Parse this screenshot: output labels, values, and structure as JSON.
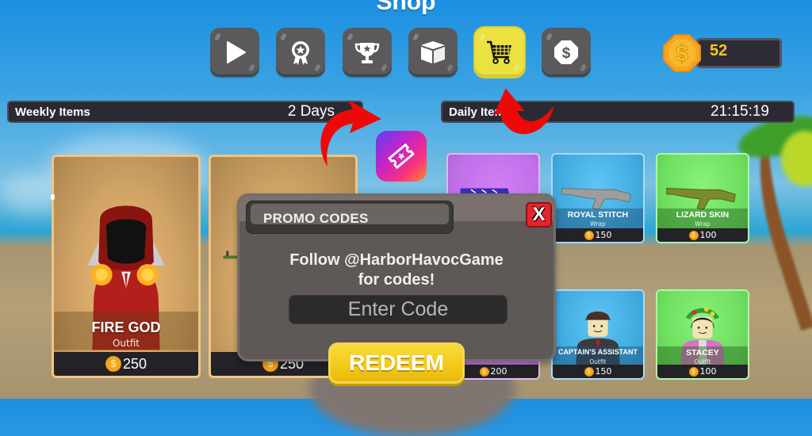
{
  "title": "Shop",
  "nav": [
    {
      "name": "play",
      "icon": "play-icon",
      "active": false
    },
    {
      "name": "rewards",
      "icon": "ribbon-award-icon",
      "active": false
    },
    {
      "name": "trophies",
      "icon": "trophy-icon",
      "active": false
    },
    {
      "name": "crates",
      "icon": "box-icon",
      "active": false
    },
    {
      "name": "shop",
      "icon": "shopping-cart-icon",
      "active": true
    },
    {
      "name": "robux",
      "icon": "dollar-coin-icon",
      "active": false
    }
  ],
  "currency": {
    "icon": "gold-coin-icon",
    "amount": "52"
  },
  "weekly": {
    "label": "Weekly Items",
    "timer": "2 Days"
  },
  "daily": {
    "label": "Daily Items",
    "timer": "21:15:19"
  },
  "weekly_items": [
    {
      "name": "FIRE GOD",
      "type": "Outfit",
      "price": "250"
    },
    {
      "name": "",
      "type": "",
      "price": "250"
    }
  ],
  "daily_items": [
    {
      "name": "",
      "type": "",
      "price": "",
      "rarity": "purple"
    },
    {
      "name": "ROYAL STITCH",
      "type": "Wrap",
      "price": "150",
      "rarity": "blue"
    },
    {
      "name": "LIZARD SKIN",
      "type": "Wrap",
      "price": "100",
      "rarity": "green"
    },
    {
      "name": "",
      "type": "",
      "price": "200",
      "rarity": "purple"
    },
    {
      "name": "CAPTAIN'S ASSISTANT",
      "type": "Outfit",
      "price": "150",
      "rarity": "blue"
    },
    {
      "name": "STACEY",
      "type": "Outfit",
      "price": "100",
      "rarity": "green"
    }
  ],
  "promo": {
    "title": "PROMO CODES",
    "close_label": "X",
    "message_line1": "Follow @HarborHavocGame",
    "message_line2": "for codes!",
    "input_placeholder": "Enter Code",
    "input_value": "",
    "redeem_label": "REDEEM"
  },
  "promo_button": {
    "icon": "ticket-icon"
  },
  "coin_glyph": "$",
  "colors": {
    "accent_yellow": "#ebe141",
    "coin": "#f7c61c",
    "close_red": "#e3262b",
    "redeem": "#f3c818"
  }
}
